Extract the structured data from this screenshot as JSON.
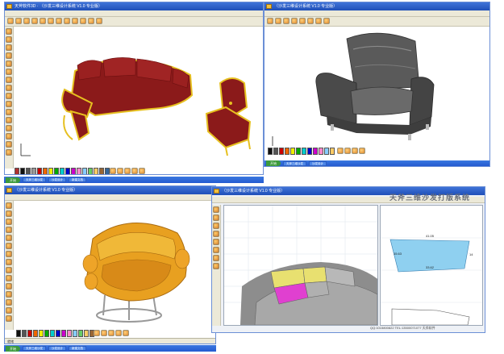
{
  "windows": {
    "top_left": {
      "title": "天斧软件3D · （沙发三维设计系统 V1.0 专业版）",
      "statusbar": "就绪"
    },
    "top_right": {
      "title": "（沙发三维设计系统 V1.0 专业版）"
    },
    "bottom_left": {
      "title": "（沙发三维设计系统 V1.0 专业版）",
      "statusbar": "就绪"
    },
    "bottom_right": {
      "title": "（沙发三维设计系统 V1.0 专业版）",
      "banner": "天斧三维沙发打版系统",
      "pattern_dims": {
        "top": "41.05",
        "left": "15.63",
        "bottom": "33.62",
        "right": "14"
      },
      "footer": "QQ:1015800822  TEL:13500071077  天斧软件"
    }
  },
  "taskbars": {
    "top": {
      "start_label": "开始",
      "items": [
        "天斧三维沙发",
        "沙发设计",
        "新建文档"
      ]
    },
    "bottom": {
      "start_label": "开始",
      "items": [
        "天斧三维沙发",
        "沙发设计",
        "新建文档"
      ]
    }
  },
  "colors": {
    "sofa_red": "#8b1a1a",
    "sofa_gold": "#e6c020",
    "armchair_gray": "#5a5a5a",
    "orange_chair": "#e8a020",
    "pattern_blue": "#8fd0f0",
    "pattern_yellow": "#e8e070",
    "pattern_magenta": "#e040d0",
    "window_blue": "#2d5fc8"
  },
  "icons": {
    "toolbar": "sofa-tool-icon",
    "palette": "color-swatch-icon"
  }
}
